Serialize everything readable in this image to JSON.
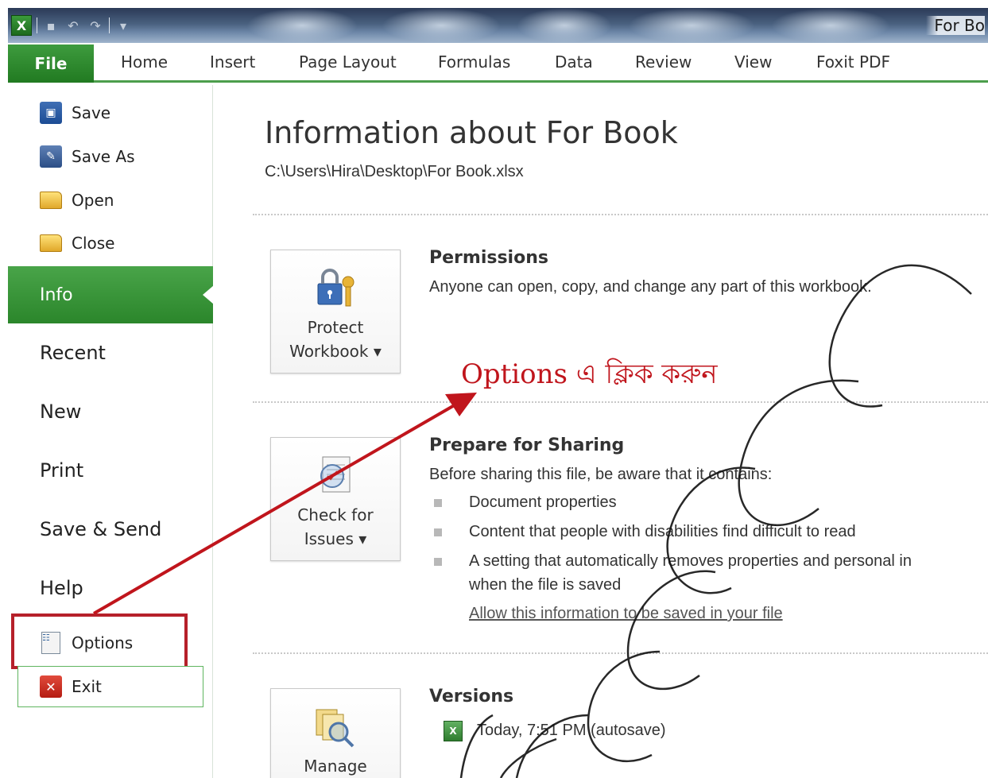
{
  "titlebar": {
    "window_title": "For Bo"
  },
  "ribbon": {
    "tabs": [
      "File",
      "Home",
      "Insert",
      "Page Layout",
      "Formulas",
      "Data",
      "Review",
      "View",
      "Foxit PDF"
    ]
  },
  "nav": {
    "save": "Save",
    "save_as": "Save As",
    "open": "Open",
    "close": "Close",
    "info": "Info",
    "recent": "Recent",
    "new": "New",
    "print": "Print",
    "save_send": "Save & Send",
    "help": "Help",
    "options": "Options",
    "exit": "Exit"
  },
  "main": {
    "title": "Information about For Book",
    "path": "C:\\Users\\Hira\\Desktop\\For Book.xlsx",
    "permissions": {
      "button_line1": "Protect",
      "button_line2": "Workbook ▾",
      "title": "Permissions",
      "text": "Anyone can open, copy, and change any part of this workbook."
    },
    "sharing": {
      "button_line1": "Check for",
      "button_line2": "Issues ▾",
      "title": "Prepare for Sharing",
      "intro": "Before sharing this file, be aware that it contains:",
      "items": [
        "Document properties",
        "Content that people with disabilities find difficult to read",
        "A setting that automatically removes properties and personal in"
      ],
      "item3_cont": "when the file is saved",
      "link": "Allow this information to be saved in your file"
    },
    "versions": {
      "button_line1": "Manage",
      "title": "Versions",
      "entry": "Today, 7:51 PM (autosave)"
    }
  },
  "annotation": {
    "text": "Options এ ক্লিক  করুন",
    "color": "#c0151c"
  },
  "colors": {
    "file_tab": "#2e8b2e",
    "highlight_box": "#b6202a"
  }
}
